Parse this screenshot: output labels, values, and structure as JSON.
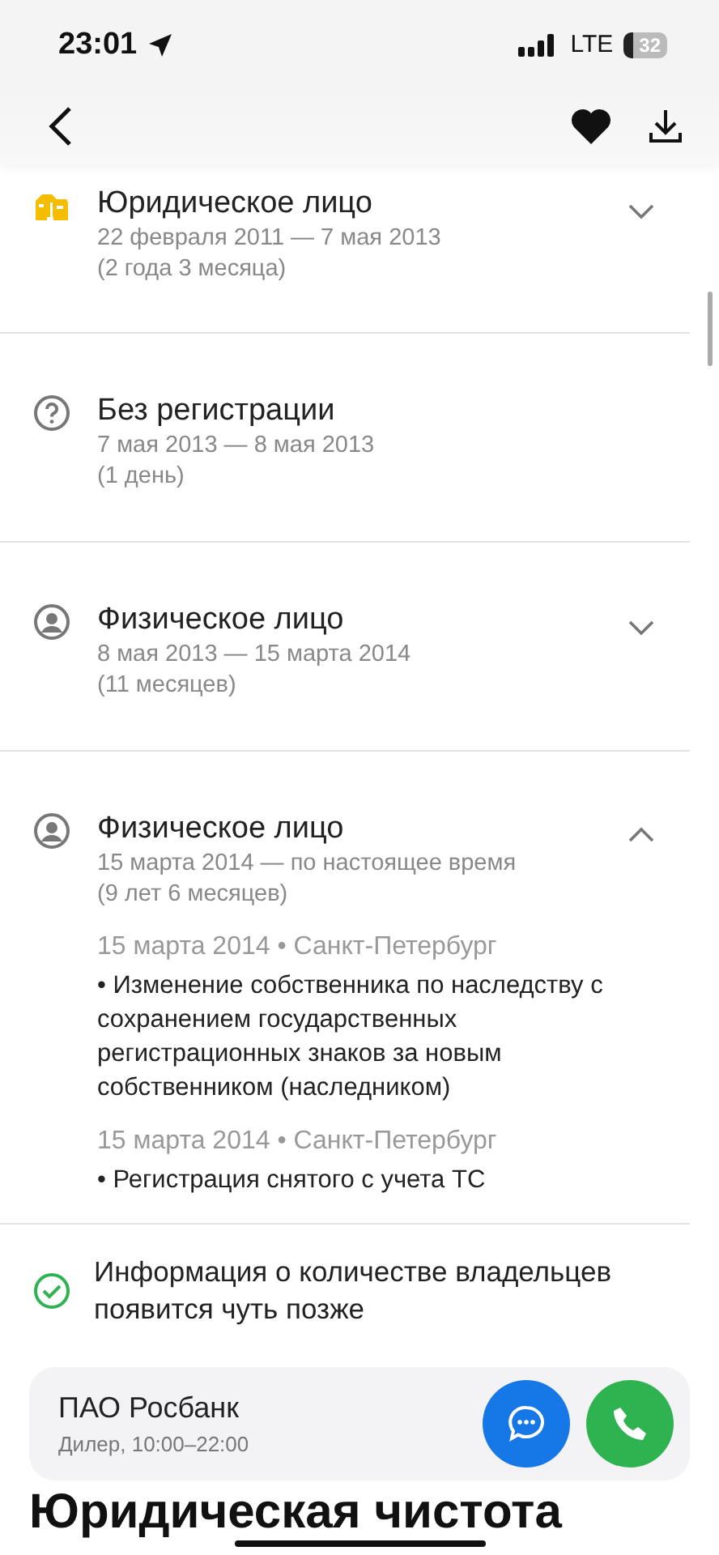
{
  "status_bar": {
    "time": "23:01",
    "network": "LTE",
    "battery": "32"
  },
  "owners": [
    {
      "kind": "company",
      "title": "Юридическое лицо",
      "period": "22 февраля 2011 — 7 мая 2013",
      "duration": "(2 года 3 месяца)",
      "expanded": false
    },
    {
      "kind": "unknown",
      "title": "Без регистрации",
      "period": "7 мая 2013 — 8 мая 2013",
      "duration": "(1 день)"
    },
    {
      "kind": "person",
      "title": "Физическое лицо",
      "period": "8 мая 2013 — 15 марта 2014",
      "duration": "(11 месяцев)",
      "expanded": false
    },
    {
      "kind": "person",
      "title": "Физическое лицо",
      "period": "15 марта 2014 — по настоящее время",
      "duration": "(9 лет 6 месяцев)",
      "expanded": true,
      "events": [
        {
          "meta": "15 марта 2014 • Санкт-Петербург",
          "text": "• Изменение собственника по наследству с сохранением государственных регистрационных знаков за новым собственником (наследником)"
        },
        {
          "meta": "15 марта 2014 • Санкт-Петербург",
          "text": "• Регистрация снятого с учета ТС"
        }
      ]
    }
  ],
  "notice": "Информация о количестве владельцев появится чуть позже",
  "dealer": {
    "name": "ПАО Росбанк",
    "details": "Дилер, 10:00–22:00"
  },
  "section_title": "Юридическая чистота"
}
